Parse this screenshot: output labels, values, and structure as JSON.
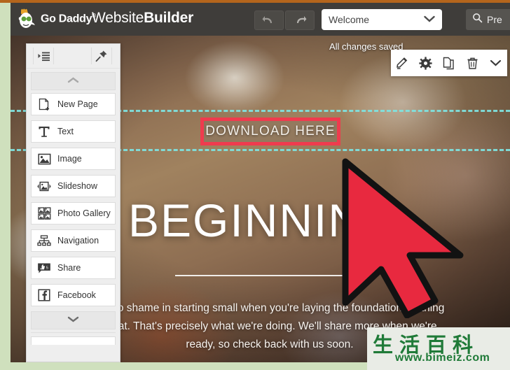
{
  "app": {
    "brand_name": "Go Daddy",
    "brand_tm": "®",
    "title_light": "Website",
    "title_bold": "Builder",
    "header_bg": "#3f3d3a",
    "frame_color": "#cfe0bd",
    "top_strip_color": "#b4651c"
  },
  "header": {
    "undo_icon": "undo-arrow-icon",
    "redo_icon": "redo-arrow-icon",
    "page_selector": {
      "value": "Welcome",
      "chevron": "chevron-down-icon"
    },
    "preview_button": {
      "label": "Pre",
      "icon": "search-icon"
    }
  },
  "panel": {
    "collapse_icon": "collapse-list-icon",
    "pin_icon": "pushpin-icon",
    "scroll_up_icon": "chevron-up-icon",
    "scroll_down_icon": "chevron-down-icon",
    "items": [
      {
        "label": "New Page",
        "icon": "new-page-icon"
      },
      {
        "label": "Text",
        "icon": "text-icon"
      },
      {
        "label": "Image",
        "icon": "image-icon"
      },
      {
        "label": "Slideshow",
        "icon": "slideshow-icon"
      },
      {
        "label": "Photo Gallery",
        "icon": "photo-gallery-icon"
      },
      {
        "label": "Navigation",
        "icon": "navigation-icon"
      },
      {
        "label": "Share",
        "icon": "share-icon"
      },
      {
        "label": "Facebook",
        "icon": "facebook-icon"
      }
    ]
  },
  "element_toolbar": {
    "tools": [
      {
        "name": "edit-pencil-icon"
      },
      {
        "name": "settings-gear-icon"
      },
      {
        "name": "duplicate-icon"
      },
      {
        "name": "delete-trash-icon"
      },
      {
        "name": "more-chevron-down-icon"
      }
    ]
  },
  "site": {
    "status_text": "All changes saved",
    "download_button_label": "DOWNLOAD HERE",
    "download_button_border_color": "#ef3b4e",
    "selection_color": "#7fe3e0",
    "headline": "BEGINNING",
    "body_text": "e's no shame in starting small when you're laying the foundation for thing great. That's precisely what we're doing. We'll share more when we're ready, so check back with us soon."
  },
  "cursor": {
    "name": "mouse-pointer-arrow",
    "fill": "#e8293f",
    "stroke": "#121212"
  },
  "watermark": {
    "chinese_text": "生活百科",
    "url": "www.bimeiz.com",
    "color": "#1f7a38"
  }
}
